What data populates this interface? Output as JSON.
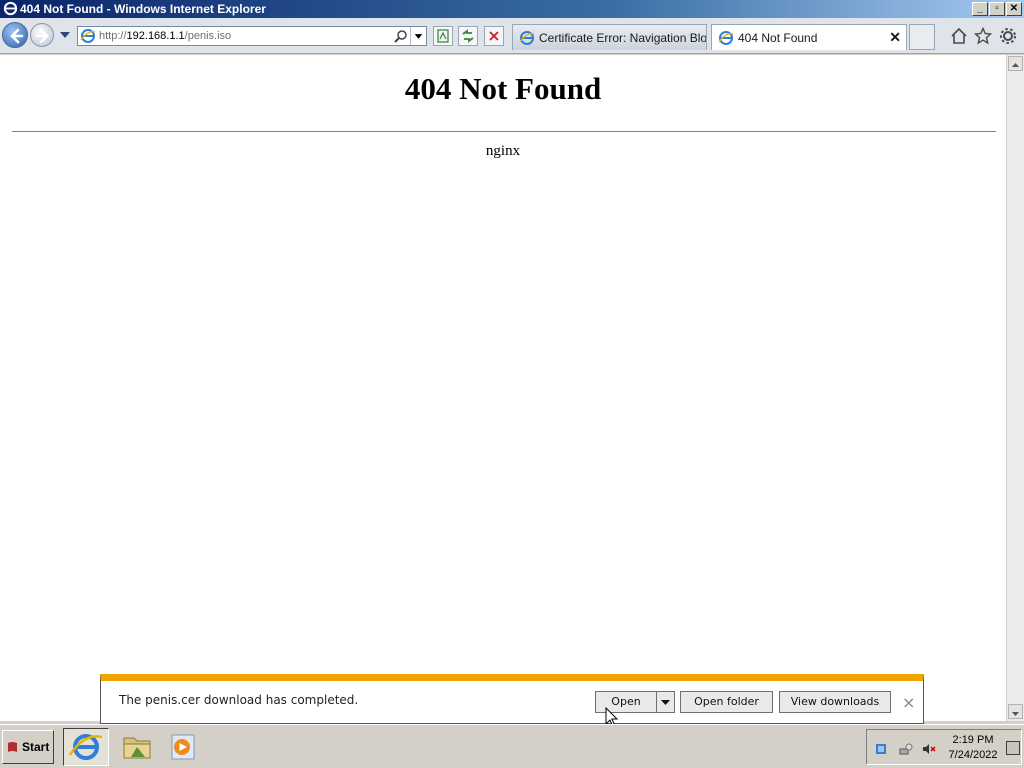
{
  "window": {
    "title": "404 Not Found - Windows Internet Explorer"
  },
  "address_bar": {
    "url_prefix": "http://",
    "url_host": "192.168.1.1",
    "url_path": "/penis.iso"
  },
  "tabs": [
    {
      "label": "Certificate Error: Navigation Blo...",
      "active": false
    },
    {
      "label": "404 Not Found",
      "active": true
    }
  ],
  "page": {
    "heading": "404 Not Found",
    "server": "nginx"
  },
  "download_bar": {
    "message": "The penis.cer download has completed.",
    "open_label": "Open",
    "open_folder_label": "Open folder",
    "view_downloads_label": "View downloads",
    "close_glyph": "×",
    "accent_color": "#f0a400"
  },
  "taskbar": {
    "start_label": "Start",
    "clock": {
      "time": "2:19 PM",
      "date": "7/24/2022"
    }
  }
}
